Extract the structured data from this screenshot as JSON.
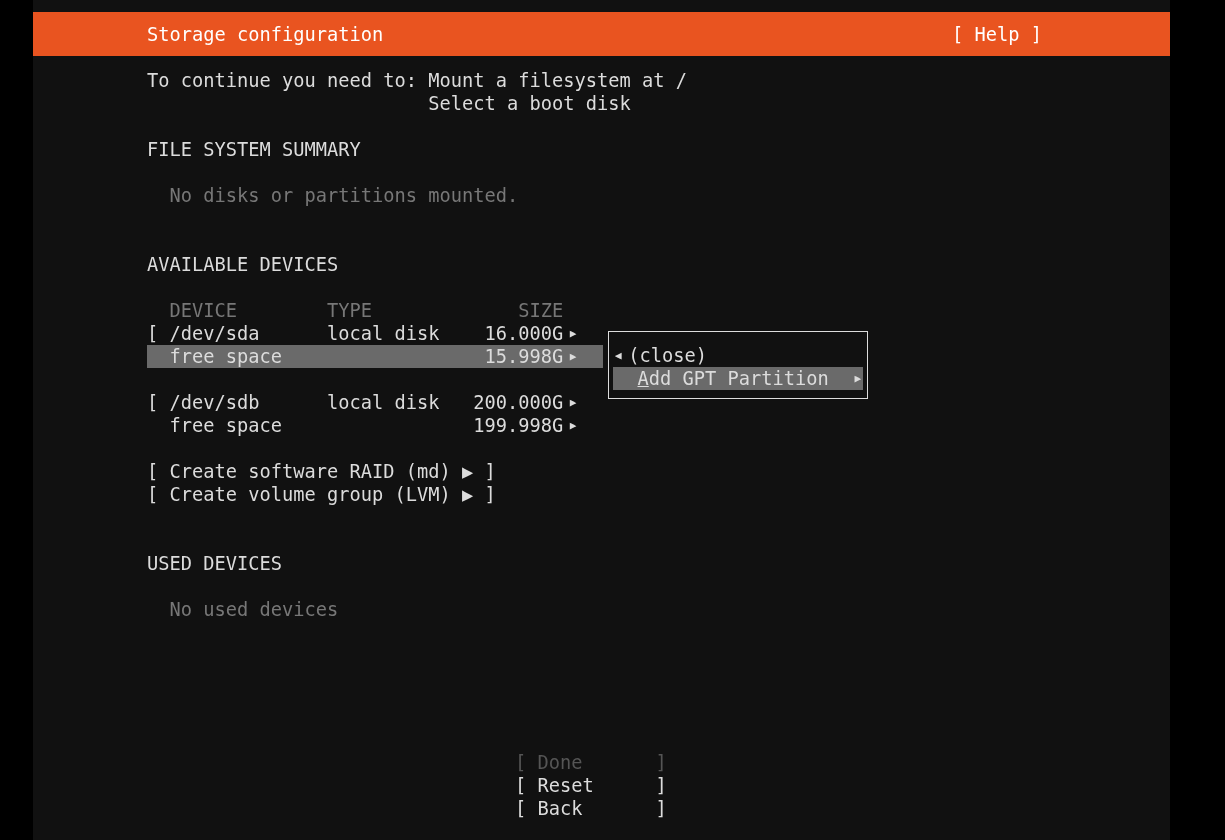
{
  "header": {
    "title": "Storage configuration",
    "help": "[ Help ]"
  },
  "intro": {
    "label": "To continue you need to:",
    "items": [
      "Mount a filesystem at /",
      "Select a boot disk"
    ]
  },
  "file_system_summary": {
    "heading": "FILE SYSTEM SUMMARY",
    "empty_text": "No disks or partitions mounted."
  },
  "available_devices": {
    "heading": "AVAILABLE DEVICES",
    "columns": [
      "DEVICE",
      "TYPE",
      "SIZE"
    ],
    "rows": [
      {
        "kind": "disk",
        "bracket": "[",
        "device": "/dev/sda",
        "type": "local disk",
        "size": "16.000G",
        "arrow": "▶",
        "selected": false
      },
      {
        "kind": "partition",
        "device": "free space",
        "size": "15.998G",
        "arrow": "▶",
        "selected": true
      },
      {
        "kind": "disk",
        "bracket": "[",
        "device": "/dev/sdb",
        "type": "local disk",
        "size": "200.000G",
        "arrow": "▶",
        "selected": false
      },
      {
        "kind": "partition",
        "device": "free space",
        "size": "199.998G",
        "arrow": "▶",
        "selected": false
      }
    ],
    "menu": {
      "items": [
        {
          "kind": "back",
          "arrow": "◀",
          "label": "(close)",
          "underline_first": false,
          "selected": false
        },
        {
          "kind": "submenu",
          "arrow": "▶",
          "label": "Add GPT Partition",
          "underline_first": true,
          "selected": true
        }
      ]
    },
    "actions": [
      "[ Create software RAID (md) ▶ ]",
      "[ Create volume group (LVM) ▶ ]"
    ]
  },
  "used_devices": {
    "heading": "USED DEVICES",
    "empty_text": "No used devices"
  },
  "buttons": [
    {
      "open": "[",
      "label": "Done",
      "close": "]",
      "disabled": true
    },
    {
      "open": "[",
      "label": "Reset",
      "close": "]",
      "disabled": false
    },
    {
      "open": "[",
      "label": "Back",
      "close": "]",
      "disabled": false
    }
  ]
}
